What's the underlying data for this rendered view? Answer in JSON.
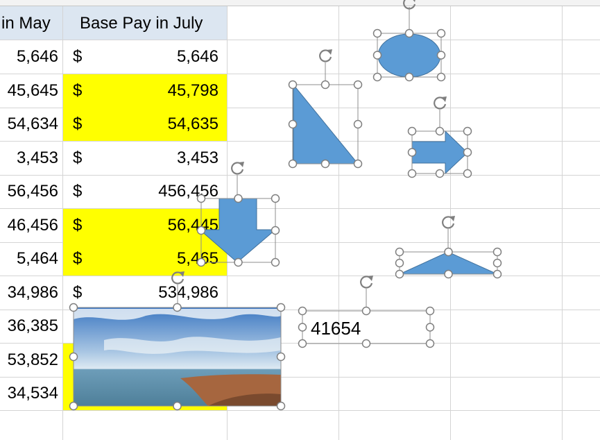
{
  "sheet": {
    "col_c_header": "in May",
    "col_d_header": "Base Pay in July",
    "rows": [
      {
        "may": "5,646",
        "dollar": "$",
        "july": "5,646",
        "highlight": false
      },
      {
        "may": "45,645",
        "dollar": "$",
        "july": "45,798",
        "highlight": true
      },
      {
        "may": "54,634",
        "dollar": "$",
        "july": "54,635",
        "highlight": true
      },
      {
        "may": "3,453",
        "dollar": "$",
        "july": "3,453",
        "highlight": false
      },
      {
        "may": "56,456",
        "dollar": "$",
        "july": "456,456",
        "highlight": false
      },
      {
        "may": "46,456",
        "dollar": "$",
        "july": "56,445",
        "highlight": true
      },
      {
        "may": "5,464",
        "dollar": "$",
        "july": "5,465",
        "highlight": true
      },
      {
        "may": "34,986",
        "dollar": "$",
        "july": "534,986",
        "highlight": false
      },
      {
        "may": "36,385",
        "dollar": "",
        "july": "",
        "highlight": false
      },
      {
        "may": "53,852",
        "dollar": "",
        "july": "",
        "highlight": true
      },
      {
        "may": "34,534",
        "dollar": "",
        "july": "",
        "highlight": true
      }
    ]
  },
  "textbox": {
    "value": "41654"
  },
  "shapes": {
    "fill_color": "#5b9bd5",
    "outline_color": "#41719c",
    "icons": [
      "ellipse-shape",
      "right-triangle-shape",
      "right-arrow-shape",
      "down-arrow-shape",
      "trapezoid-shape",
      "landscape-picture",
      "rotate-handle-icon"
    ]
  },
  "colors": {
    "highlight": "#ffff00",
    "header_fill": "#dce6f1",
    "gridline": "#d4d4d4"
  }
}
